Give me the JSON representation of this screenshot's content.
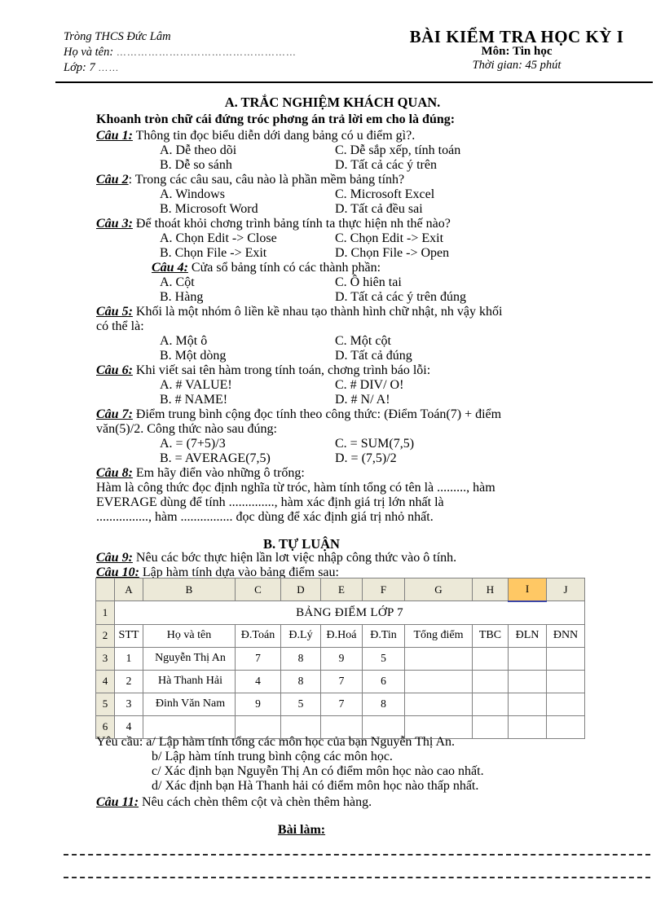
{
  "header": {
    "school": "Tròng   THCS Đức Lâm",
    "name_label": "Họ và tên:",
    "name_dots": "……………………………………………",
    "class_label": "Lớp: 7",
    "class_dots": "……",
    "title": "BÀI  KIỂM TRA HỌC KỲ I",
    "subject": "Môn: Tin học",
    "duration": "Thời gian: 45 phút"
  },
  "part_a": {
    "title": "A. TRẮC NGHIỆM KHÁCH QUAN.",
    "instruction": "Khoanh tròn chữ cái đứng tróc   phơng   án trả lời em cho là đúng:",
    "questions": [
      {
        "label": "Câu 1:",
        "text": " Thông tin đọc   biểu diễn dới   dang bảng có u   điểm gì?.",
        "a": "A. Dễ theo dõi",
        "b": "B. Dễ so sánh",
        "c": "C. Dễ sắp xếp, tính toán",
        "d": "D. Tất cả các ý trên"
      },
      {
        "label": "Câu 2",
        "text": ": Trong các câu sau, câu nào là phần mềm bảng tính?",
        "a": "A. Windows",
        "b": "B. Microsoft Word",
        "c": "C. Microsoft Excel",
        "d": "D. Tất cả đều sai"
      },
      {
        "label": "Câu 3:",
        "text": " Để thoát khỏi chơng   trình bảng tính ta thực hiện nh   thế nào?",
        "a": "A. Chọn Edit -> Close",
        "b": "B. Chọn File -> Exit",
        "c": "C. Chọn Edit -> Exit",
        "d": "D. Chọn File -> Open"
      },
      {
        "label": "Câu 4:",
        "text": " Cửa sổ bảng tính có các thành phần:",
        "a": "A. Cột",
        "b": "B. Hàng",
        "c": "C. Ô hiên tai",
        "d": "D. Tất cả các ý trên đúng"
      },
      {
        "label": "Câu 5:",
        "text": " Khối là một nhóm ô liền kề nhau tạo thành hình chữ nhật, nh   vậy khối",
        "text2": "có thể là:",
        "a": "A. Một ô",
        "b": "B. Một dòng",
        "c": "C. Một cột",
        "d": "D. Tất cả đúng"
      },
      {
        "label": "Câu 6:",
        "text": " Khi viết sai tên hàm trong tính toán, chơng   trình báo lỗi:",
        "a": "A. # VALUE!",
        "b": "B. # NAME!",
        "c": "C. # DIV/ O!",
        "d": "D. # N/ A!"
      },
      {
        "label": "Câu 7:",
        "text": " Điểm trung bình cộng đọc   tính theo công thức: (Điểm Toán(7) + điểm",
        "text2": "văn(5)/2. Công thức nào sau đúng:",
        "a": "A. = (7+5)/3",
        "b": "B. = AVERAGE(7,5)",
        "c": "C. = SUM(7,5)",
        "d": "D. = (7,5)/2"
      },
      {
        "label": "Câu 8:",
        "text": " Em hãy điển vào những ô trống:",
        "fill1": "Hàm là công thức đọc   định nghĩa từ tróc,   hàm tính tổng có tên là .........,   hàm",
        "fill2": "EVERAGE dùng để tính ..............,      hàm xác định giá trị lớn nhất là",
        "fill3": "................,    hàm ................    đọc   dùng để xác định giá trị nhỏ nhất."
      }
    ]
  },
  "part_b": {
    "title": "B. TỰ LUẬN",
    "q9_label": "Câu 9:",
    "q9_text": "  Nêu các bớc   thực hiện lần lơt   việc nhập công thức vào ô tính.",
    "q10_label": "Câu 10:",
    "q10_text": " Lập hàm tính dựa vào bảng điểm sau:",
    "requirements": [
      "Yêu cầu: a/ Lập hàm tính tổng các môn học của bạn Nguyễn Thị An.",
      "b/ Lập hàm tính trung bình cộng các môn học.",
      "c/ Xác định bạn Nguyễn Thị An có điểm môn học nào cao nhất.",
      "d/ Xác định bạn Hà Thanh hải có điểm môn học nào thấp nhất."
    ],
    "q11_label": "Câu 11:",
    "q11_text": " Nêu cách chèn thêm cột và chèn thêm hàng."
  },
  "spreadsheet": {
    "column_letters": [
      "A",
      "B",
      "C",
      "D",
      "E",
      "F",
      "G",
      "H",
      "I",
      "J"
    ],
    "selected_column": "I",
    "selected_color": "#ffc864",
    "row_numbers": [
      "1",
      "2",
      "3",
      "4",
      "5",
      "6"
    ],
    "title_row": "BẢNG ĐIỂM LỚP 7",
    "headers": [
      "STT",
      "Họ và tên",
      "Đ.Toán",
      "Đ.Lý",
      "Đ.Hoá",
      "Đ.Tin",
      "Tổng điểm",
      "TBC",
      "ĐLN",
      "ĐNN"
    ],
    "rows": [
      {
        "stt": "1",
        "name": "Nguyễn Thị An",
        "toan": "7",
        "ly": "8",
        "hoa": "9",
        "tin": "5",
        "tong": "",
        "tbc": "",
        "dln": "",
        "dnn": ""
      },
      {
        "stt": "2",
        "name": "Hà Thanh Hải",
        "toan": "4",
        "ly": "8",
        "hoa": "7",
        "tin": "6",
        "tong": "",
        "tbc": "",
        "dln": "",
        "dnn": ""
      },
      {
        "stt": "3",
        "name": "Đinh Văn Nam",
        "toan": "9",
        "ly": "5",
        "hoa": "7",
        "tin": "8",
        "tong": "",
        "tbc": "",
        "dln": "",
        "dnn": ""
      },
      {
        "stt": "4",
        "name": "",
        "toan": "",
        "ly": "",
        "hoa": "",
        "tin": "",
        "tong": "",
        "tbc": "",
        "dln": "",
        "dnn": ""
      }
    ]
  },
  "answer_section": {
    "label": "Bài làm"
  }
}
